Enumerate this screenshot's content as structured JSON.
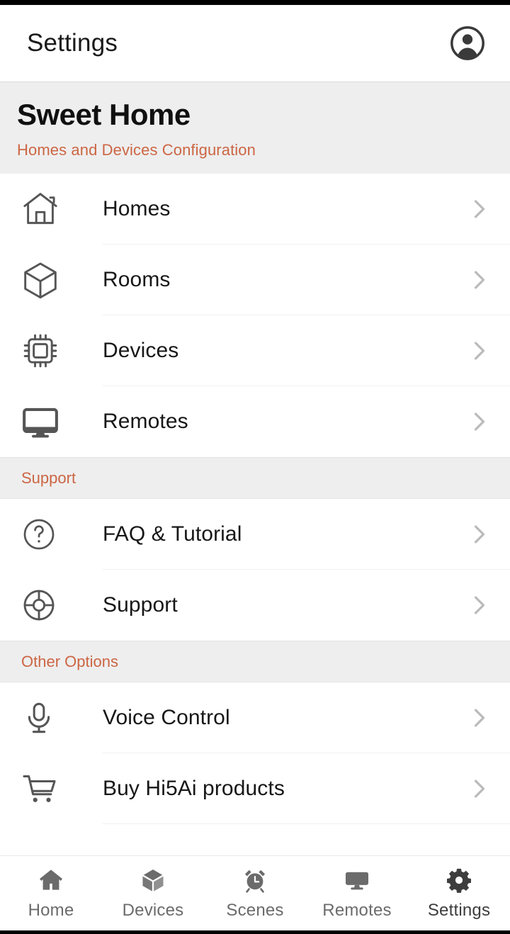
{
  "appbar": {
    "title": "Settings",
    "account_icon": "account-circle-icon"
  },
  "page_header": {
    "title": "Sweet Home",
    "subtitle": "Homes and Devices Configuration",
    "accent_color": "#cc6644",
    "background_color": "#eeeeee"
  },
  "sections": [
    {
      "header": null,
      "items": [
        {
          "label": "Homes",
          "icon": "house-outline-icon",
          "chevron": "chevron-right-icon"
        },
        {
          "label": "Rooms",
          "icon": "cube-outline-icon",
          "chevron": "chevron-right-icon"
        },
        {
          "label": "Devices",
          "icon": "cpu-chip-icon",
          "chevron": "chevron-right-icon"
        },
        {
          "label": "Remotes",
          "icon": "monitor-icon",
          "chevron": "chevron-right-icon"
        }
      ]
    },
    {
      "header": "Support",
      "items": [
        {
          "label": "FAQ & Tutorial",
          "icon": "question-circle-icon",
          "chevron": "chevron-right-icon"
        },
        {
          "label": "Support",
          "icon": "lifebuoy-icon",
          "chevron": "chevron-right-icon"
        }
      ]
    },
    {
      "header": "Other Options",
      "items": [
        {
          "label": "Voice Control",
          "icon": "microphone-icon",
          "chevron": "chevron-right-icon"
        },
        {
          "label": "Buy Hi5Ai products",
          "icon": "shopping-cart-icon",
          "chevron": "chevron-right-icon"
        }
      ]
    }
  ],
  "bottom_nav": {
    "active": "Settings",
    "items": [
      {
        "label": "Home",
        "icon": "home-filled-icon"
      },
      {
        "label": "Devices",
        "icon": "cube-filled-icon"
      },
      {
        "label": "Scenes",
        "icon": "alarm-clock-icon"
      },
      {
        "label": "Remotes",
        "icon": "monitor-filled-icon"
      },
      {
        "label": "Settings",
        "icon": "gear-icon"
      }
    ]
  },
  "colors": {
    "accent": "#cc6644",
    "text_primary": "#171717",
    "text_muted": "#6b6b6b",
    "chevron": "#bbbbbb",
    "divider": "#f0f0f0",
    "section_bg": "#eeeeee"
  }
}
